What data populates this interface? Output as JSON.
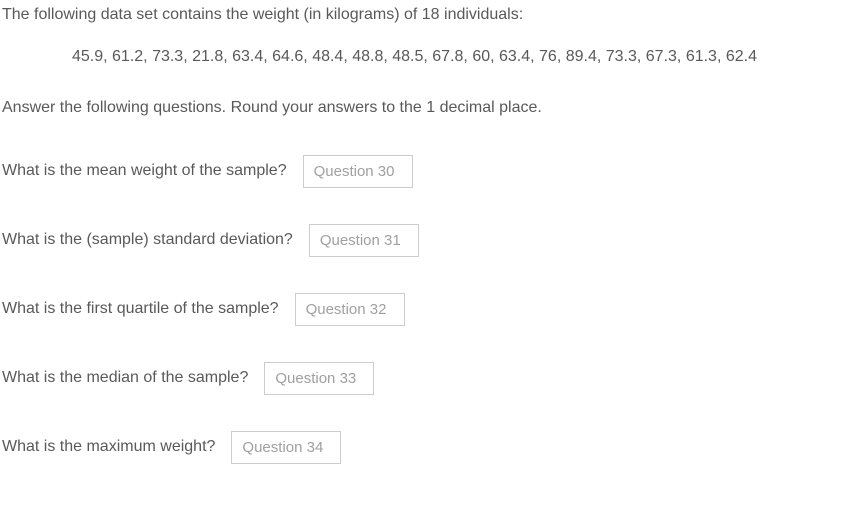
{
  "intro": "The following data set contains the weight (in kilograms) of 18 individuals:",
  "dataset": "45.9, 61.2, 73.3, 21.8, 63.4, 64.6, 48.4, 48.8, 48.5, 67.8, 60, 63.4, 76, 89.4, 73.3, 67.3, 61.3, 62.4",
  "instruction": "Answer the following questions. Round your answers to the 1 decimal place.",
  "questions": [
    {
      "label": "What is the mean weight of the sample?",
      "placeholder": "Question 30"
    },
    {
      "label": "What is the (sample) standard deviation?",
      "placeholder": "Question 31"
    },
    {
      "label": "What is the first quartile of the sample?",
      "placeholder": "Question 32"
    },
    {
      "label": "What is the median of the sample?",
      "placeholder": "Question 33"
    },
    {
      "label": "What is the maximum weight?",
      "placeholder": "Question 34"
    }
  ]
}
